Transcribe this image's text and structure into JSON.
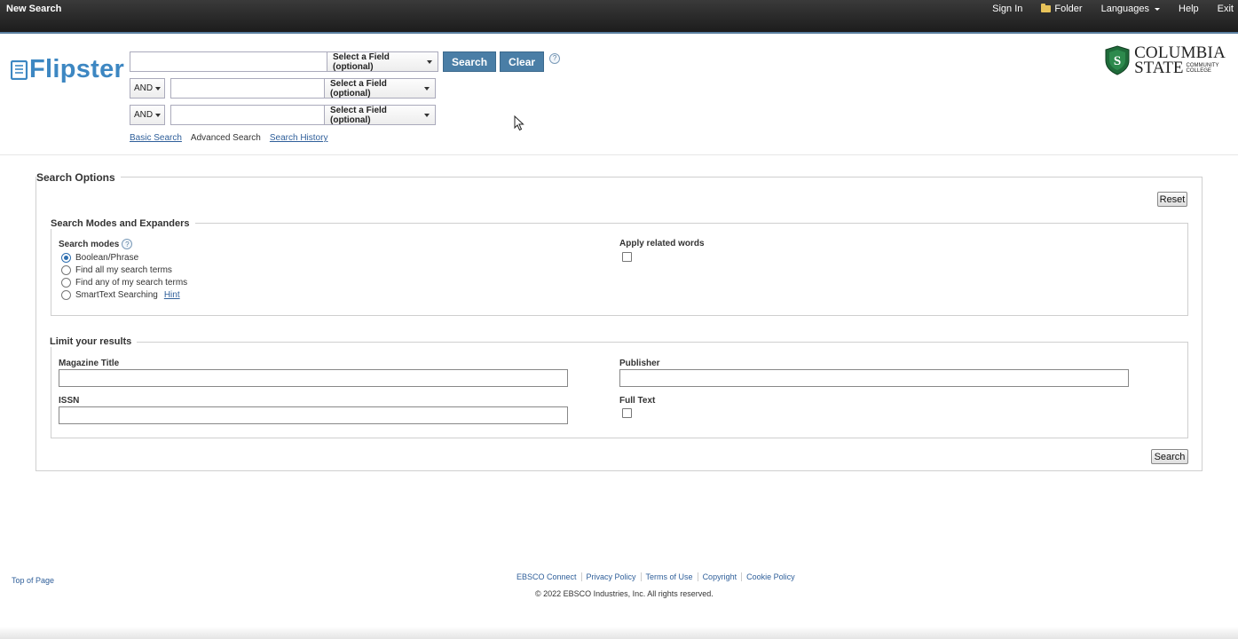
{
  "topbar": {
    "title": "New Search",
    "links": {
      "sign_in": "Sign In",
      "folder": "Folder",
      "languages": "Languages",
      "help": "Help",
      "exit": "Exit"
    }
  },
  "brand": {
    "logo_text": "Flipster",
    "accent": "#3d87c2"
  },
  "college": {
    "line1": "COLUMBIA",
    "line2": "STATE",
    "line3": "COMMUNITY",
    "line4": "COLLEGE"
  },
  "search": {
    "field_select": "Select a Field (optional)",
    "operator": "AND",
    "rows": [
      {
        "value": "",
        "field": "Select a Field (optional)"
      },
      {
        "operator": "AND",
        "value": "",
        "field": "Select a Field (optional)"
      },
      {
        "operator": "AND",
        "value": "",
        "field": "Select a Field (optional)"
      }
    ],
    "search_label": "Search",
    "clear_label": "Clear",
    "help": "?"
  },
  "nav": {
    "basic": "Basic Search",
    "advanced": "Advanced Search",
    "history": "Search History"
  },
  "options": {
    "title": "Search Options",
    "reset_label": "Reset",
    "modes_section": {
      "title": "Search Modes and Expanders",
      "modes_label": "Search modes",
      "modes_help": "?",
      "modes": [
        {
          "label": "Boolean/Phrase",
          "selected": true
        },
        {
          "label": "Find all my search terms",
          "selected": false
        },
        {
          "label": "Find any of my search terms",
          "selected": false
        },
        {
          "label": "SmartText Searching",
          "selected": false
        }
      ],
      "hint": "Hint",
      "related_words_label": "Apply related words"
    },
    "limit_section": {
      "title": "Limit your results",
      "magazine_title_label": "Magazine Title",
      "publisher_label": "Publisher",
      "issn_label": "ISSN",
      "full_text_label": "Full Text"
    },
    "search_label": "Search"
  },
  "footer": {
    "top_of_page": "Top of Page",
    "links": [
      "EBSCO Connect",
      "Privacy Policy",
      "Terms of Use",
      "Copyright",
      "Cookie Policy"
    ],
    "copyright": "© 2022 EBSCO Industries, Inc. All rights reserved."
  }
}
